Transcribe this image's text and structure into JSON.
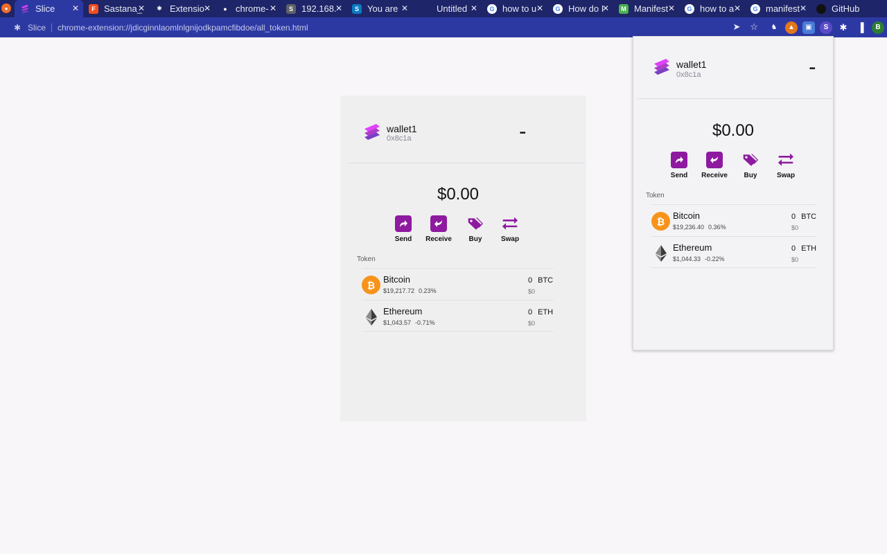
{
  "browser": {
    "tabs": [
      {
        "title": "Slice",
        "active": true,
        "icon": "slice-logo-icon",
        "color": "#7b3fc4"
      },
      {
        "title": "Sastana_",
        "icon": "figma-icon",
        "color": "#f24e1e"
      },
      {
        "title": "Extensio",
        "icon": "puzzle-icon",
        "color": "#1e2568"
      },
      {
        "title": "chrome-",
        "icon": "github-icon",
        "color": "#1e2568"
      },
      {
        "title": "192.168.",
        "icon": "s-icon",
        "color": "#5f6368"
      },
      {
        "title": "You are",
        "icon": "s-icon",
        "color": "#0b7ac4"
      },
      {
        "title": "Untitled",
        "icon": "blank-icon",
        "color": "#1e2568"
      },
      {
        "title": "how to u",
        "icon": "google-icon",
        "color": "#ffffff"
      },
      {
        "title": "How do I",
        "icon": "google-icon",
        "color": "#ffffff"
      },
      {
        "title": "Manifest",
        "icon": "manifest-icon",
        "color": "#4caf50"
      },
      {
        "title": "how to a",
        "icon": "google-icon",
        "color": "#ffffff"
      },
      {
        "title": "manifest",
        "icon": "google-icon",
        "color": "#ffffff"
      },
      {
        "title": "GitHub",
        "icon": "github-icon",
        "color": "#1e2568"
      }
    ],
    "close_glyph": "✕",
    "omnibox": {
      "site": "Slice",
      "url": "chrome-extension://jdicginnlaomlnlgnijodkpamcfibdoe/all_token.html"
    },
    "profile_initial": "B"
  },
  "main_wallet": {
    "account_name": "wallet1",
    "account_address": "0x8c1a",
    "menu_glyph": "•••",
    "balance": "$0.00",
    "actions": [
      {
        "label": "Send",
        "icon": "send-icon"
      },
      {
        "label": "Receive",
        "icon": "receive-icon"
      },
      {
        "label": "Buy",
        "icon": "tag-icon"
      },
      {
        "label": "Swap",
        "icon": "swap-icon"
      }
    ],
    "token_heading": "Token",
    "tokens": [
      {
        "name": "Bitcoin",
        "price": "$19,217.72",
        "change": "0.23%",
        "amount": "0",
        "symbol": "BTC",
        "fiat": "$0"
      },
      {
        "name": "Ethereum",
        "price": "$1,043.57",
        "change": "-0.71%",
        "amount": "0",
        "symbol": "ETH",
        "fiat": "$0"
      }
    ]
  },
  "popup_wallet": {
    "account_name": "wallet1",
    "account_address": "0x8c1a",
    "menu_glyph": "•••",
    "balance": "$0.00",
    "actions": [
      {
        "label": "Send",
        "icon": "send-icon"
      },
      {
        "label": "Receive",
        "icon": "receive-icon"
      },
      {
        "label": "Buy",
        "icon": "tag-icon"
      },
      {
        "label": "Swap",
        "icon": "swap-icon"
      }
    ],
    "token_heading": "Token",
    "tokens": [
      {
        "name": "Bitcoin",
        "price": "$19,236.40",
        "change": "0.36%",
        "amount": "0",
        "symbol": "BTC",
        "fiat": "$0"
      },
      {
        "name": "Ethereum",
        "price": "$1,044.33",
        "change": "-0.22%",
        "amount": "0",
        "symbol": "ETH",
        "fiat": "$0"
      }
    ]
  },
  "colors": {
    "accent": "#8e1aa0",
    "tabbar": "#1e2568",
    "toolbar": "#2d39a3",
    "btc": "#f7931a"
  }
}
